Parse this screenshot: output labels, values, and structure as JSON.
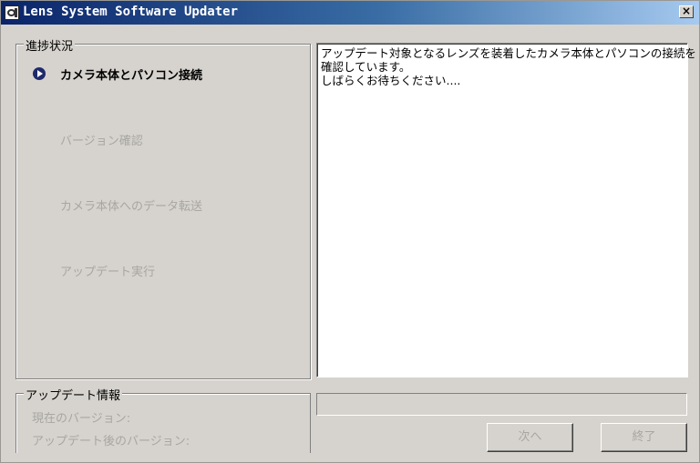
{
  "window": {
    "title": "Lens System Software Updater",
    "close_symbol": "×"
  },
  "progress": {
    "legend": "進捗状況",
    "steps": [
      {
        "label": "カメラ本体とパソコン接続",
        "state": "active"
      },
      {
        "label": "バージョン確認",
        "state": "inactive"
      },
      {
        "label": "カメラ本体へのデータ転送",
        "state": "inactive"
      },
      {
        "label": "アップデート実行",
        "state": "inactive"
      }
    ],
    "active_icon": "play-circle-icon"
  },
  "message": {
    "lines": [
      "アップデート対象となるレンズを装着したカメラ本体とパソコンの接続を",
      "確認しています。",
      "しばらくお待ちください...."
    ]
  },
  "update_info": {
    "legend": "アップデート情報",
    "current_version_label": "現在のバージョン:",
    "updated_version_label": "アップデート後のバージョン:"
  },
  "progress_bar": {
    "value": 0
  },
  "buttons": {
    "next": "次へ",
    "finish": "終了"
  },
  "colors": {
    "titlebar_start": "#0a246a",
    "titlebar_end": "#a6caf0",
    "disabled_text": "#a8a6a2",
    "active_icon": "#1f2a6b"
  }
}
